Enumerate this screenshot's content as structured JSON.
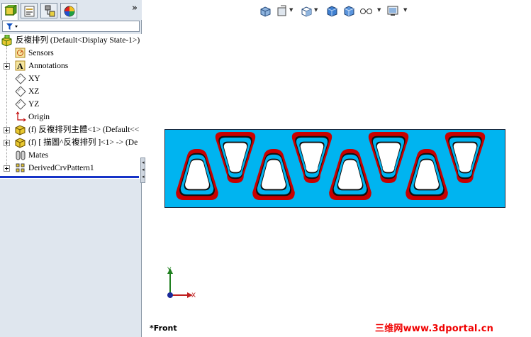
{
  "panel": {
    "expand_glyph": "»",
    "tabs": [
      {
        "name": "featuremanager-tab",
        "icon": "feature-tree-icon"
      },
      {
        "name": "propertymanager-tab",
        "icon": "property-icon"
      },
      {
        "name": "configurationmanager-tab",
        "icon": "configuration-icon"
      },
      {
        "name": "display-manager-tab",
        "icon": "appearance-icon"
      }
    ]
  },
  "tree": {
    "root": "反複排列  (Default<Display State-1>)",
    "items": [
      {
        "label": "Sensors",
        "icon": "sensor-icon"
      },
      {
        "label": "Annotations",
        "icon": "annotation-icon"
      },
      {
        "label": "XY",
        "icon": "plane-icon"
      },
      {
        "label": "XZ",
        "icon": "plane-icon"
      },
      {
        "label": "YZ",
        "icon": "plane-icon"
      },
      {
        "label": "Origin",
        "icon": "origin-icon"
      },
      {
        "label": "(f) 反複排列主體<1> (Default<<",
        "icon": "part-icon"
      },
      {
        "label": "(f) [ 描圖^反複排列 ]<1> -> (De",
        "icon": "part-icon"
      },
      {
        "label": "Mates",
        "icon": "mates-icon"
      },
      {
        "label": "DerivedCrvPattern1",
        "icon": "pattern-icon"
      }
    ]
  },
  "viewport": {
    "view_name": "*Front",
    "triad": {
      "x": "X",
      "y": "Y"
    },
    "colors": {
      "base": "#00b4f0",
      "rim": "#c80000",
      "hole": "#ffffff"
    }
  },
  "watermark": "三维网www.3dportal.cn"
}
